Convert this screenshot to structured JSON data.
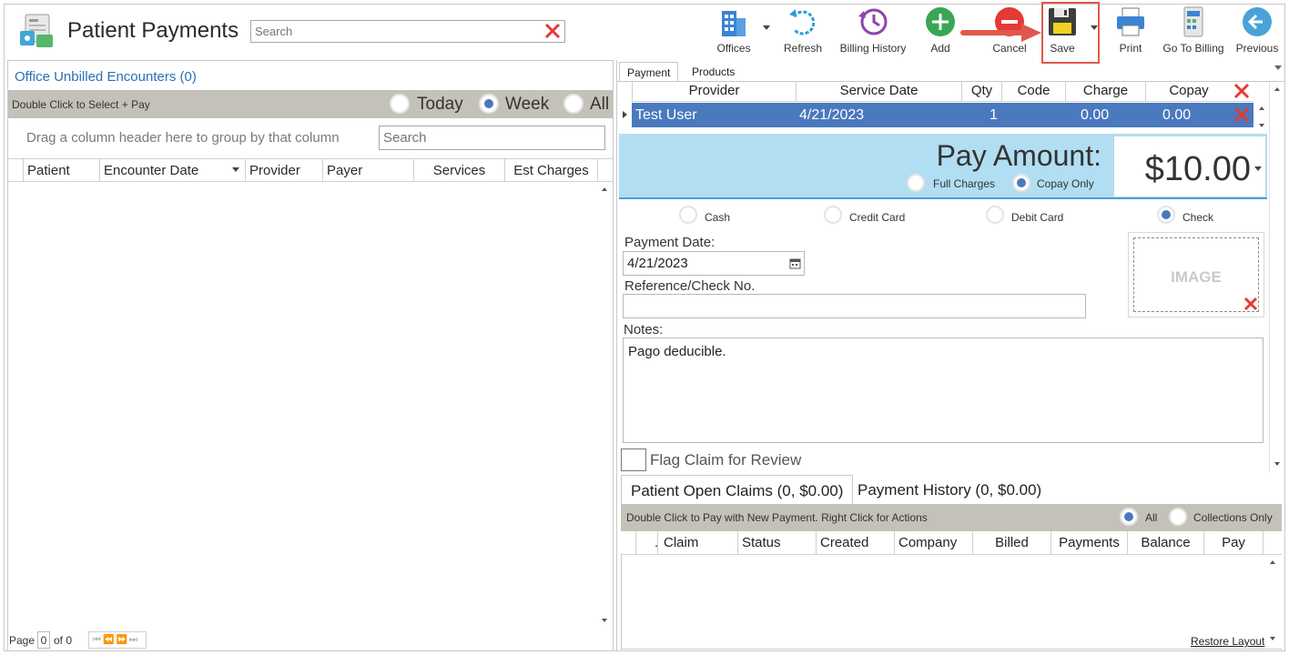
{
  "header": {
    "title": "Patient Payments",
    "search_placeholder": "Search"
  },
  "toolbar": {
    "offices": "Offices",
    "refresh": "Refresh",
    "billing_history": "Billing History",
    "add": "Add",
    "cancel": "Cancel",
    "save": "Save",
    "print": "Print",
    "go_to_billing": "Go To Billing",
    "previous": "Previous"
  },
  "left": {
    "title": "Office Unbilled Encounters (0)",
    "hint": "Double Click to Select + Pay",
    "ranges": [
      {
        "label": "Today",
        "selected": false
      },
      {
        "label": "Week",
        "selected": true
      },
      {
        "label": "All",
        "selected": false
      }
    ],
    "group_hint": "Drag a column header here to group by that column",
    "search_placeholder": "Search",
    "columns": [
      "Patient",
      "Encounter Date",
      "Provider",
      "Payer",
      "Services",
      "Est Charges"
    ],
    "pager": {
      "label": "Page",
      "value": "0",
      "of": "of 0"
    }
  },
  "right": {
    "tabs": [
      "Payment",
      "Products"
    ],
    "grid_columns": [
      "Provider",
      "Service Date",
      "Qty",
      "Code",
      "Charge",
      "Copay"
    ],
    "row": {
      "provider": "Test User",
      "service_date": "4/21/2023",
      "qty": "1",
      "code": "",
      "charge": "0.00",
      "copay": "0.00"
    },
    "pay_label": "Pay Amount:",
    "pay_amount": "$10.00",
    "pay_options": [
      {
        "label": "Full Charges",
        "selected": false
      },
      {
        "label": "Copay Only",
        "selected": true
      }
    ],
    "methods": [
      {
        "label": "Cash",
        "selected": false
      },
      {
        "label": "Credit Card",
        "selected": false
      },
      {
        "label": "Debit Card",
        "selected": false
      },
      {
        "label": "Check",
        "selected": true
      }
    ],
    "payment_date_label": "Payment Date:",
    "payment_date": "4/21/2023",
    "reference_label": "Reference/Check No.",
    "reference_value": "",
    "notes_label": "Notes:",
    "notes": "Pago deducible.",
    "image_text": "IMAGE",
    "flag_label": "Flag Claim for Review",
    "flag_checked": false,
    "bottom_tabs": [
      "Patient Open Claims (0, $0.00)",
      "Payment History (0, $0.00)"
    ],
    "claims_hint": "Double Click to Pay with New Payment. Right Click for Actions",
    "claims_filter": [
      {
        "label": "All",
        "selected": true
      },
      {
        "label": "Collections Only",
        "selected": false
      }
    ],
    "claims_columns": [
      ".",
      "Claim",
      "Status",
      "Created",
      "Company",
      "Billed",
      "Payments",
      "Balance",
      "Pay"
    ],
    "restore_layout": "Restore Layout"
  },
  "colors": {
    "accent": "#4a79be",
    "pay_band": "#b1def2",
    "bar": "#c4c2b8",
    "link": "#2a6fb5",
    "highlight": "#e0584c"
  }
}
